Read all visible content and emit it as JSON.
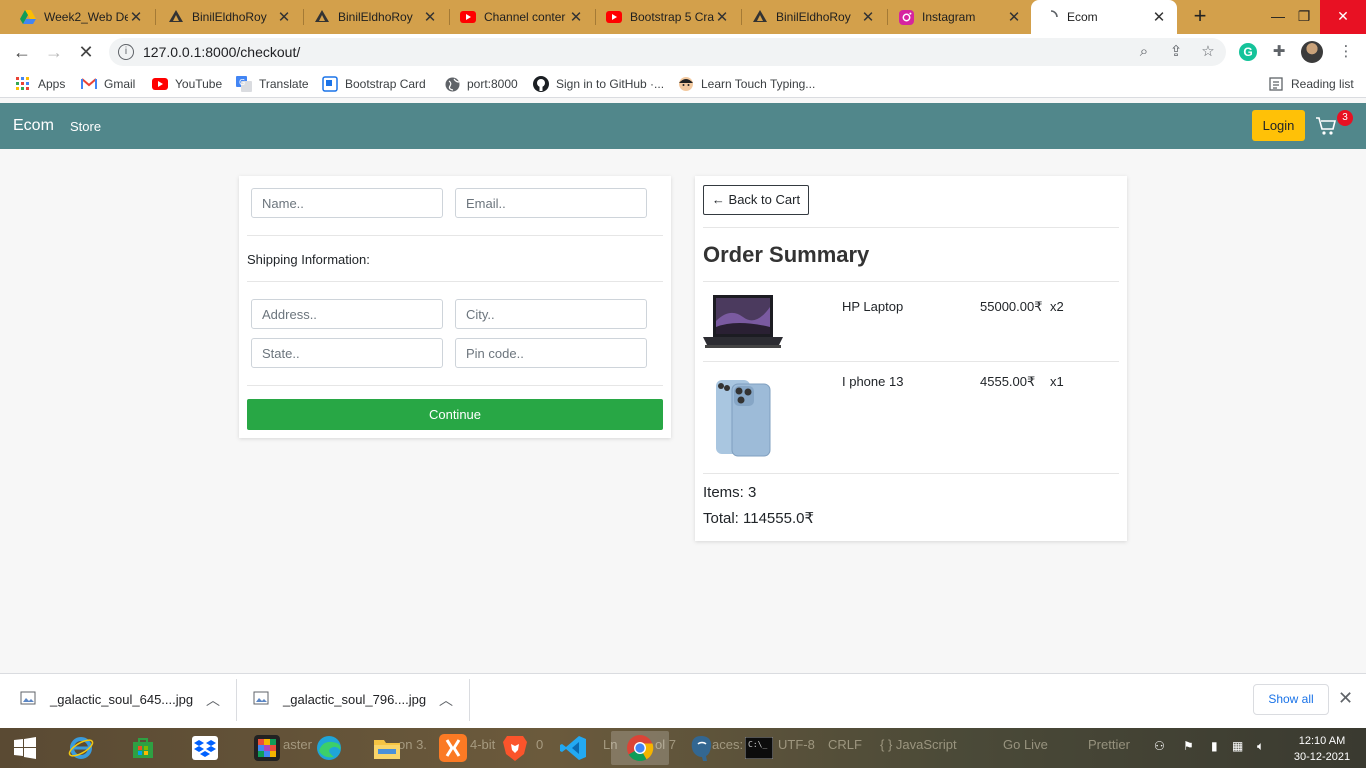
{
  "browser": {
    "tabs": [
      {
        "title": "Week2_Web De",
        "icon": "google-drive-icon"
      },
      {
        "title": "BinilEldhoRoy",
        "icon": "github-user-icon"
      },
      {
        "title": "BinilEldhoRoy",
        "icon": "github-user-icon"
      },
      {
        "title": "Channel conter",
        "icon": "youtube-icon"
      },
      {
        "title": "Bootstrap 5 Cra",
        "icon": "youtube-icon"
      },
      {
        "title": "BinilEldhoRoy",
        "icon": "github-user-icon"
      },
      {
        "title": "Instagram",
        "icon": "instagram-icon"
      },
      {
        "title": "Ecom",
        "icon": "loading-icon",
        "active": true
      }
    ],
    "url": "127.0.0.1:8000/checkout/",
    "bookmarks": [
      {
        "label": "Apps",
        "icon": "apps-grid-icon"
      },
      {
        "label": "Gmail",
        "icon": "gmail-icon"
      },
      {
        "label": "YouTube",
        "icon": "youtube-icon"
      },
      {
        "label": "Translate",
        "icon": "translate-icon"
      },
      {
        "label": "Bootstrap Card",
        "icon": "bootstrap-icon"
      },
      {
        "label": "port:8000",
        "icon": "globe-icon"
      },
      {
        "label": "Sign in to GitHub ·...",
        "icon": "github-icon"
      },
      {
        "label": "Learn Touch Typing...",
        "icon": "typing-icon"
      }
    ],
    "reading_list": "Reading list",
    "profile_initial": "G"
  },
  "navbar": {
    "brand": "Ecom",
    "store_link": "Store",
    "login_label": "Login",
    "cart_count": "3"
  },
  "form": {
    "name_placeholder": "Name..",
    "email_placeholder": "Email..",
    "shipping_label": "Shipping Information:",
    "address_placeholder": "Address..",
    "city_placeholder": "City..",
    "state_placeholder": "State..",
    "pincode_placeholder": "Pin code..",
    "continue_label": "Continue"
  },
  "summary": {
    "back_label": "← Back to Cart",
    "title": "Order Summary",
    "items": [
      {
        "name": "HP Laptop",
        "price": "55000.00₹",
        "qty": "x2",
        "image": "laptop-image"
      },
      {
        "name": "I phone 13",
        "price": "4555.00₹",
        "qty": "x1",
        "image": "phone-image"
      }
    ],
    "items_text": "Items: 3",
    "total_text": "Total: 114555.0₹"
  },
  "downloads": {
    "files": [
      "_galactic_soul_645....jpg",
      "_galactic_soul_796....jpg"
    ],
    "show_all": "Show all"
  },
  "taskbar": {
    "time": "12:10 AM",
    "date": "30-12-2021",
    "ghost_texts": [
      "aster",
      "on 3.",
      "4-bit",
      "0",
      "Ln",
      "ol 7",
      "aces:",
      "UTF-8",
      "CRLF",
      "{ } JavaScript",
      "Go Live",
      "Prettier"
    ]
  }
}
